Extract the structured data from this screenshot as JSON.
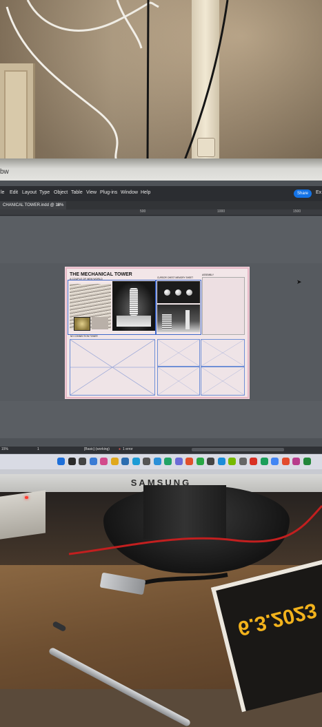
{
  "monitor": {
    "brand": "SAMSUNG",
    "title_fragment": "bw"
  },
  "app": {
    "menu": [
      "le",
      "Edit",
      "Layout",
      "Type",
      "Object",
      "Table",
      "View",
      "Plug-ins",
      "Window",
      "Help"
    ],
    "share_label": "Share",
    "share_fragment": "Ex",
    "document_tab": "CHANICAL TOWER.indd @ 13%",
    "ruler_marks": [
      "500",
      "1000",
      "1500"
    ],
    "zoom": "15%",
    "page_indicator": "1",
    "preflight": "[Basic] (working)",
    "errors": "1 error"
  },
  "layout_page": {
    "title": "THE MECHANICAL TOWER",
    "subtitle": "A COUPLE OF NEW WORLD",
    "label_a": "CURSOR CHEST MEMORY SHEET",
    "label_b": "ASSEMBLY",
    "label_c": "NO CONNECTION TOWER"
  },
  "taskbar": {
    "icon_colors": [
      "#1e6fd9",
      "#2a2a2a",
      "#444",
      "#3a7bd5",
      "#d24a8c",
      "#e0a81e",
      "#2b6cb0",
      "#1c9bd6",
      "#555",
      "#2a8fd8",
      "#21a366",
      "#6b6bd6",
      "#e04f2b",
      "#28a745",
      "#444",
      "#1a8cd8",
      "#76b900",
      "#666",
      "#d93025",
      "#1b9e5a",
      "#4285f4",
      "#e24a2d",
      "#b83c8c",
      "#22863a"
    ]
  },
  "poster": {
    "date_text": "6.3.2023"
  }
}
